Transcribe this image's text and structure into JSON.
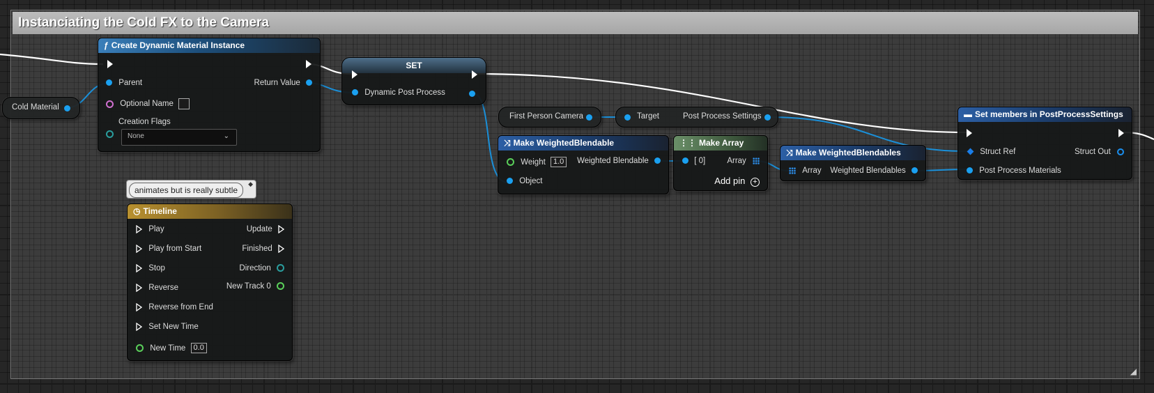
{
  "comment": {
    "title": "Instanciating the Cold FX to the Camera"
  },
  "cold_material": {
    "label": "Cold Material"
  },
  "create_dmi": {
    "title": "Create Dynamic Material Instance",
    "icon": "function-icon",
    "pin_parent": "Parent",
    "pin_optional_name": "Optional Name",
    "pin_creation_flags": "Creation Flags",
    "creation_flags_value": "None",
    "pin_return_value": "Return Value"
  },
  "set_node": {
    "title": "SET",
    "pin_dynamic_post_process": "Dynamic Post Process"
  },
  "first_person_camera": {
    "label": "First Person Camera"
  },
  "post_process_settings_getter": {
    "pin_target": "Target",
    "pin_output": "Post Process Settings"
  },
  "make_weighted_blendable": {
    "title": "Make WeightedBlendable",
    "pin_weight": "Weight",
    "weight_value": "1.0",
    "pin_object": "Object",
    "pin_output": "Weighted Blendable"
  },
  "make_array": {
    "title": "Make Array",
    "pin_index0": "[ 0]",
    "pin_array": "Array",
    "add_pin": "Add pin"
  },
  "make_weighted_blendables": {
    "title": "Make WeightedBlendables",
    "pin_array": "Array",
    "pin_output": "Weighted Blendables"
  },
  "set_members": {
    "title": "Set members in PostProcessSettings",
    "pin_struct_ref": "Struct Ref",
    "pin_post_process_materials": "Post Process Materials",
    "pin_struct_out": "Struct Out"
  },
  "timeline_comment": {
    "text": "animates but is really subtle"
  },
  "timeline": {
    "title": "Timeline",
    "inputs": [
      "Play",
      "Play from Start",
      "Stop",
      "Reverse",
      "Reverse from End",
      "Set New Time"
    ],
    "outputs": [
      "Update",
      "Finished"
    ],
    "pin_direction": "Direction",
    "pin_new_track": "New Track 0",
    "pin_new_time": "New Time",
    "new_time_value": "0.0"
  },
  "colors": {
    "exec_wire": "#ffffff",
    "data_wire": "#1a8fd8",
    "struct_pin": "#1a7ee8",
    "float_pin": "#5ad05a",
    "name_pin": "#d070d0",
    "enum_pin": "#2a9e9e"
  }
}
